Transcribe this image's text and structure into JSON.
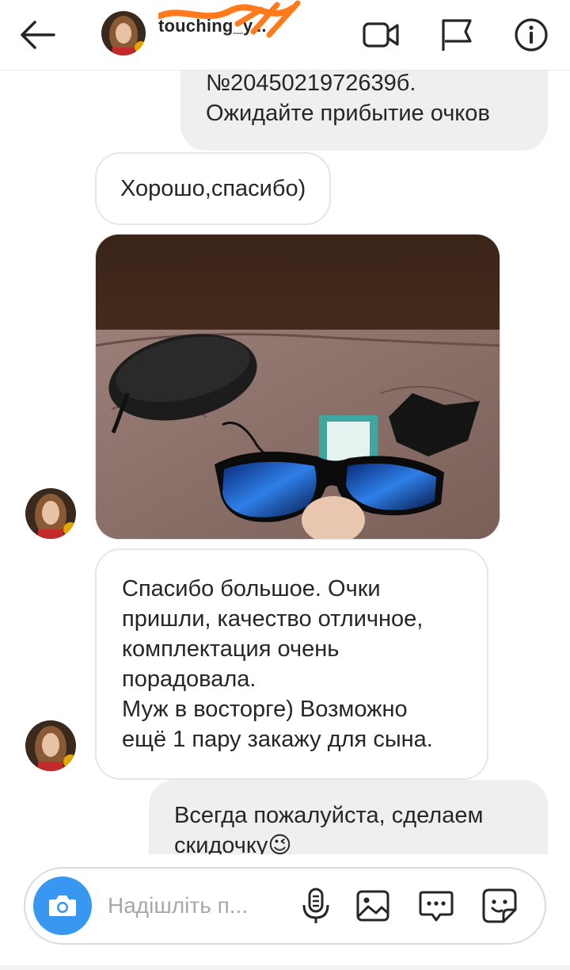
{
  "header": {
    "username": "touching_y...",
    "icons": [
      "back-arrow-icon",
      "video-call-icon",
      "flag-icon",
      "info-icon"
    ]
  },
  "messages": [
    {
      "side": "out",
      "lines": [
        "№2045021972639б.",
        "Ожидайте прибытие очков"
      ]
    },
    {
      "side": "in",
      "text": "Хорошо,спасибо)"
    },
    {
      "side": "in",
      "type": "photo",
      "content": "photo of sunglasses with case and cloth"
    },
    {
      "side": "in",
      "lines": [
        "Спасибо большое. Очки",
        "пришли, качество отличное,",
        "комплектация очень",
        "порадовала.",
        "Муж в восторге) Возможно",
        "ещё 1 пару закажу для сына."
      ]
    },
    {
      "side": "out",
      "lines": [
        "Всегда пожалуйста, сделаем",
        "скидочку😉"
      ]
    }
  ],
  "composer": {
    "placeholder": "Надішліть п...",
    "icons": [
      "camera-icon",
      "microphone-icon",
      "gallery-icon",
      "more-icon",
      "sticker-icon"
    ],
    "accent": "#3897f0"
  }
}
